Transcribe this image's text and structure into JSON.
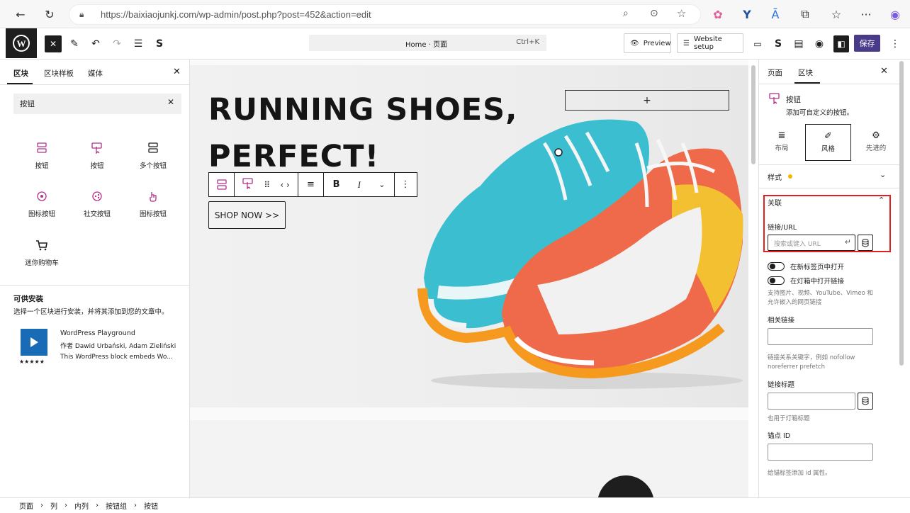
{
  "browser": {
    "url": "https://baixiaojunkj.com/wp-admin/post.php?post=452&action=edit"
  },
  "toolbar": {
    "doc_title": "Home · 页面",
    "shortcut": "Ctrl+K",
    "preview_label": "Preview",
    "website_setup_label": "Website setup",
    "save_label": "保存"
  },
  "left_panel": {
    "tabs": [
      "区块",
      "区块样板",
      "媒体"
    ],
    "search_value": "按钮",
    "blocks": [
      {
        "label": "按钮",
        "icon": "buttons-icon"
      },
      {
        "label": "按钮",
        "icon": "button-pointer-icon"
      },
      {
        "label": "多个按钮",
        "icon": "multi-buttons-icon"
      },
      {
        "label": "图标按钮",
        "icon": "icon-button-icon"
      },
      {
        "label": "社交按钮",
        "icon": "social-button-icon"
      },
      {
        "label": "图标按钮",
        "icon": "hand-button-icon"
      },
      {
        "label": "迷你购物车",
        "icon": "cart-icon"
      }
    ],
    "install_title": "可供安装",
    "install_desc": "选择一个区块进行安装，并将其添加到您的文章中。",
    "plugin": {
      "name": "WordPress Playground",
      "author": "作者 Dawid Urbański, Adam Zieliński",
      "desc": "This WordPress block embeds Wo...",
      "stars": "★★★★★"
    }
  },
  "canvas": {
    "hero_title_line1": "RUNNING SHOES,",
    "hero_title_line2": "PERFECT!",
    "shop_button": "SHOP NOW >>",
    "plus": "+"
  },
  "right_panel": {
    "tabs": [
      "页面",
      "区块"
    ],
    "block_name": "按钮",
    "block_desc": "添加可自定义的按钮。",
    "subtabs": [
      "布局",
      "风格",
      "先进的"
    ],
    "style_label": "样式",
    "link_section": "关联",
    "link_url_label": "链接/URL",
    "link_url_placeholder": "搜索或键入 URL",
    "new_tab_label": "在新标签页中打开",
    "lightbox_label": "在灯箱中打开链接",
    "lightbox_hint": "支持图片、视频、YouTube、Vimeo 和允许嵌入的网页链接",
    "rel_label": "相关链接",
    "rel_hint": "链接关系关键字，例如 nofollow noreferrer prefetch",
    "title_label": "链接标题",
    "title_hint": "也用于灯箱标题",
    "anchor_label": "锚点 ID",
    "anchor_hint": "给锚标签添加 id 属性。"
  },
  "breadcrumb": [
    "页面",
    "列",
    "内列",
    "按钮组",
    "按钮"
  ],
  "colors": {
    "save": "#4a3a8a",
    "highlight": "#e02020",
    "accent_icon": "#b0308a"
  }
}
